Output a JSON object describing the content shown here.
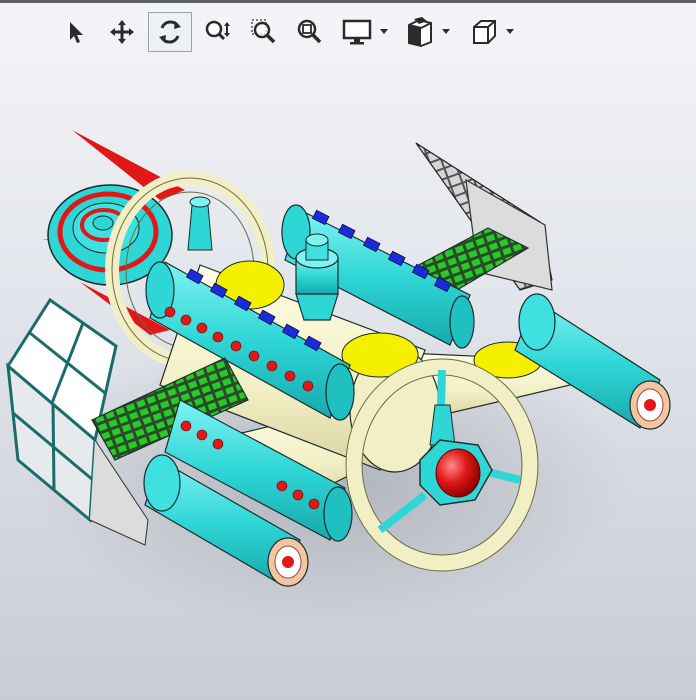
{
  "toolbar": {
    "buttons": [
      {
        "id": "select",
        "icon": "select-arrow-icon"
      },
      {
        "id": "pan",
        "icon": "pan-move-icon"
      },
      {
        "id": "rotate",
        "icon": "rotate-view-icon",
        "active": true
      },
      {
        "id": "zoom-in-out",
        "icon": "zoom-in-out-icon"
      },
      {
        "id": "zoom-to-area",
        "icon": "zoom-to-area-icon"
      },
      {
        "id": "zoom-to-fit",
        "icon": "zoom-to-fit-icon"
      },
      {
        "id": "display-style",
        "icon": "display-monitor-icon",
        "dropdown": true
      },
      {
        "id": "section-view",
        "icon": "section-view-icon",
        "dropdown": true
      },
      {
        "id": "view-orientation",
        "icon": "view-cube-icon",
        "dropdown": true
      }
    ]
  },
  "viewport": {
    "model_name": "spaceship-model",
    "colors": {
      "cyan": "#2fd6d6",
      "cream": "#f2efc6",
      "yellow": "#f5f000",
      "red": "#e01818",
      "green": "#28c928",
      "blue": "#1a2bd8",
      "outline": "#1a2c2c"
    }
  }
}
